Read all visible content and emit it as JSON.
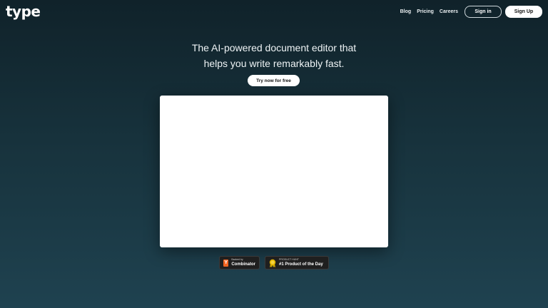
{
  "brand": {
    "name": "type"
  },
  "nav": {
    "links": [
      "Blog",
      "Pricing",
      "Careers"
    ],
    "signin_label": "Sign in",
    "signup_label": "Sign Up"
  },
  "hero": {
    "line1": "The AI-powered document editor that",
    "line2": "helps you write remarkably fast.",
    "cta_label": "Try now for free"
  },
  "badges": {
    "yc": {
      "small": "Backed by",
      "big": "Combinator",
      "icon": "Y"
    },
    "ph": {
      "small": "PRODUCT HUNT",
      "big": "#1 Product of the Day"
    }
  },
  "colors": {
    "bg_top": "#10222a",
    "bg_bottom": "#1f4250",
    "yc_orange": "#f26522",
    "medal_gold": "#e6b800"
  }
}
